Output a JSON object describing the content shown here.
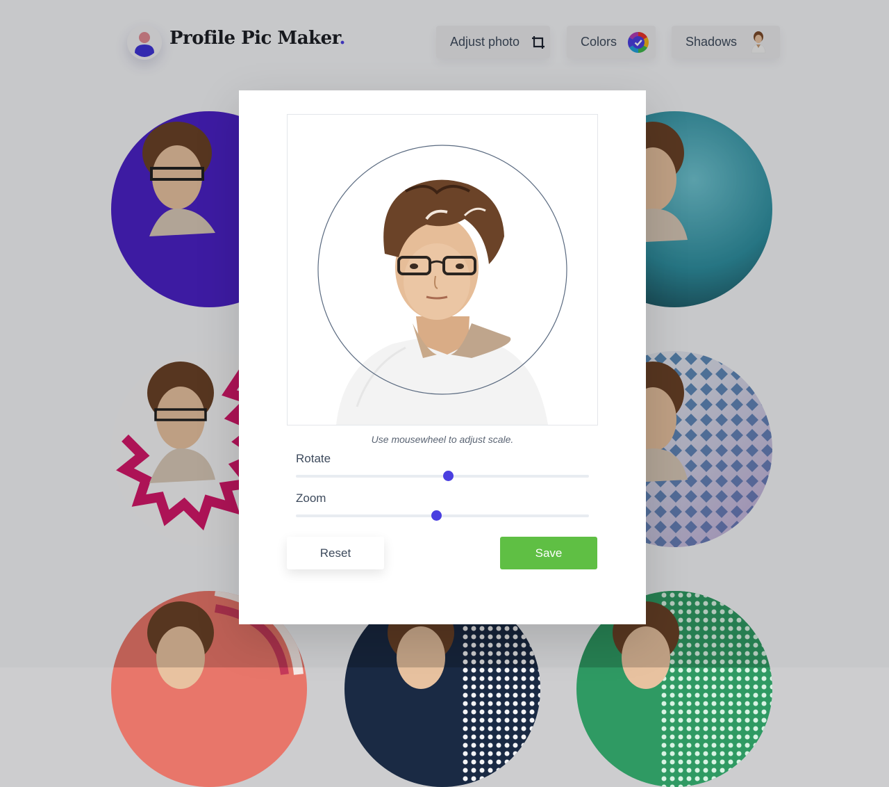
{
  "app": {
    "brand_name": "Profile Pic Maker",
    "brand_dot": "."
  },
  "nav": {
    "adjust_photo_label": "Adjust photo",
    "colors_label": "Colors",
    "shadows_label": "Shadows",
    "adjust_icon": "crop-icon",
    "colors_icon": "color-wheel-check-icon",
    "shadows_icon": "portrait-thumbnail-icon"
  },
  "editor": {
    "hint": "Use mousewheel to adjust scale.",
    "rotate_label": "Rotate",
    "rotate_value": 0.52,
    "zoom_label": "Zoom",
    "zoom_value": 0.48,
    "reset_label": "Reset",
    "save_label": "Save"
  },
  "colors": {
    "accent": "#4a3fe0",
    "save_green": "#5fbf44",
    "purple_avatar": "#4b22c6",
    "teal_avatar": "#2f8fa0",
    "pink_zigzag": "#d4186a"
  }
}
